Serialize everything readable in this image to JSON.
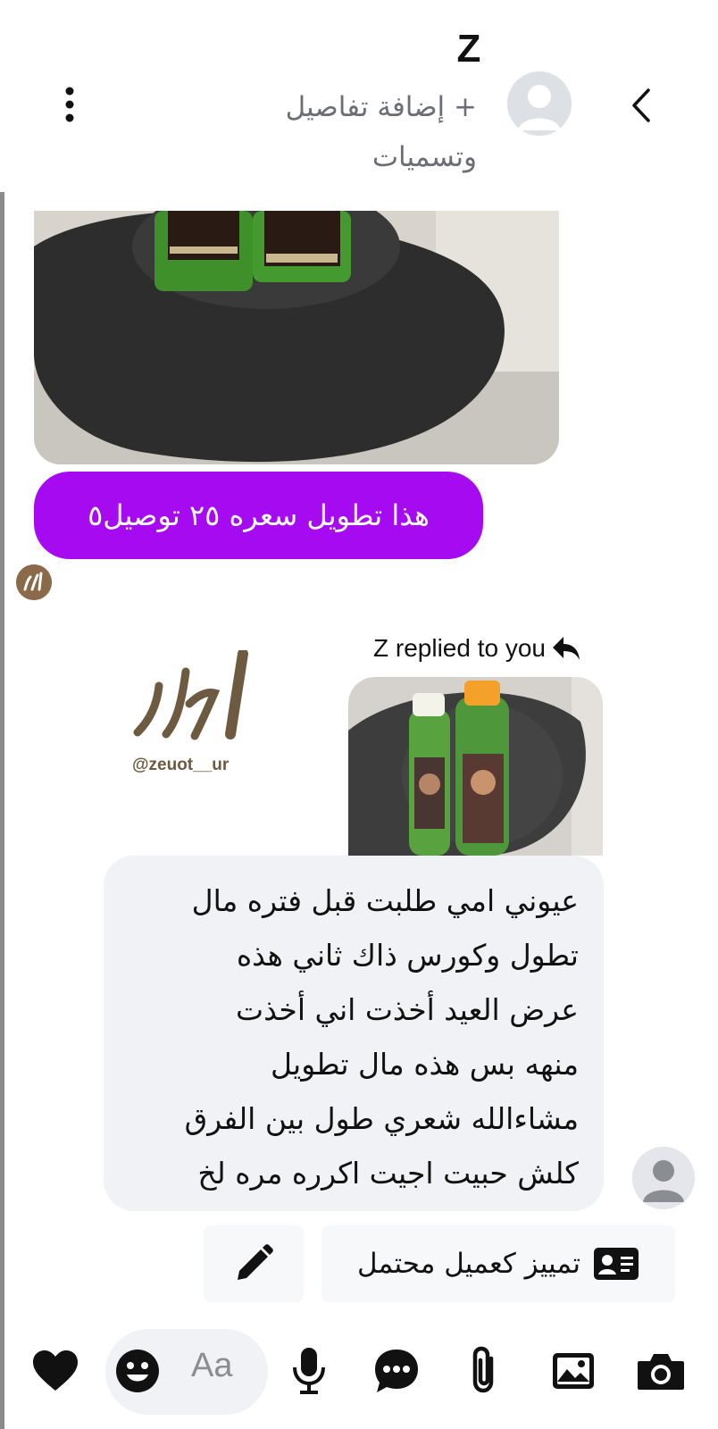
{
  "header": {
    "contact_name": "Z",
    "add_details_line1": "+ إضافة تفاصيل",
    "add_details_line2": "وتسميات"
  },
  "messages": {
    "price_text": "هذا تطويل سعره ٢٥ توصيل٥",
    "replied_label": "Z replied to you",
    "logo_handle": "@zeuot__ur",
    "reply_lines": [
      "عيوني امي طلبت قبل فتره مال",
      "تطول وكورس ذاك ثاني هذه",
      "عرض العيد أخذت اني أخذت",
      "منهه بس هذه مال تطويل",
      "مشاءالله شعري طول بين الفرق",
      "كلش حبيت اجيت اكرره مره لخ"
    ]
  },
  "actions": {
    "mark_customer_label": "تمييز كعميل محتمل"
  },
  "composer": {
    "input_placeholder": "Aa",
    "icons": [
      "camera-icon",
      "image-icon",
      "attachment-icon",
      "chat-icon",
      "microphone-icon",
      "emoji-icon",
      "heart-icon"
    ]
  },
  "colors": {
    "accent_purple": "#a60af0",
    "bubble_gray": "#f0f2f5",
    "icon_dark": "#111111"
  }
}
